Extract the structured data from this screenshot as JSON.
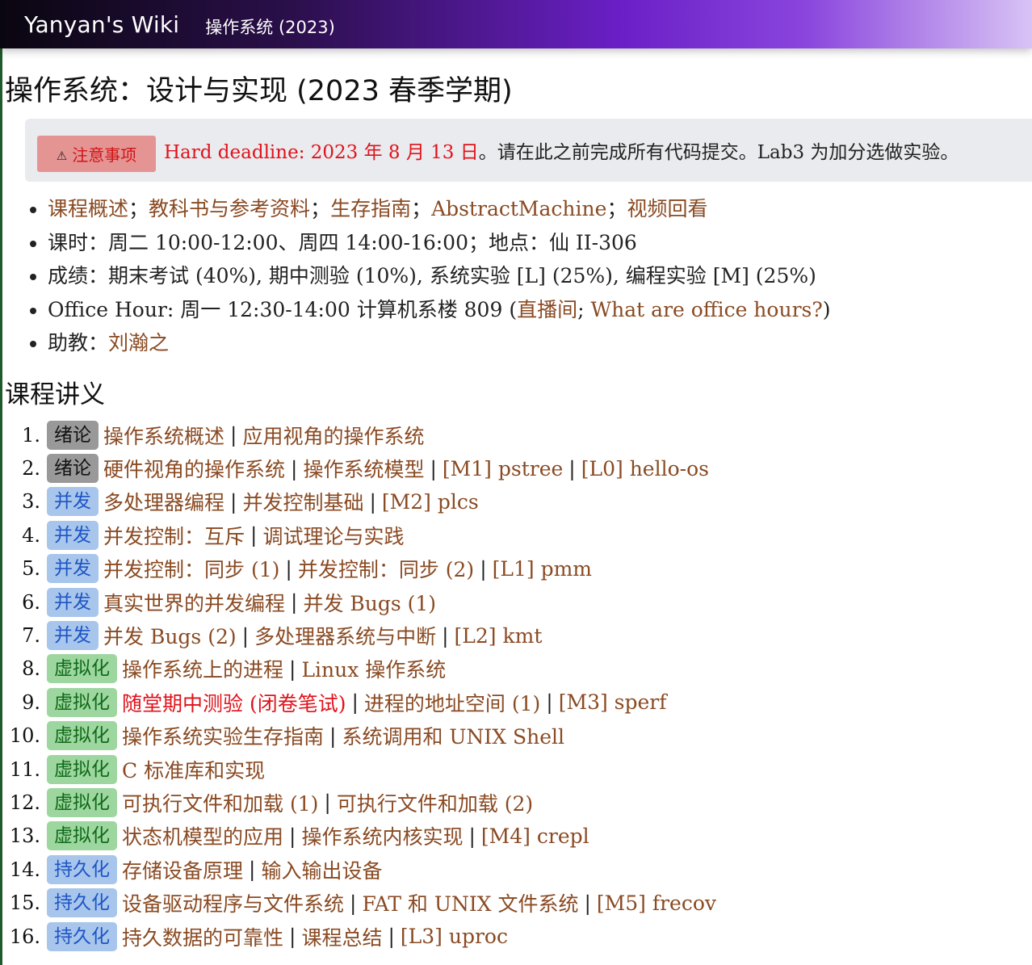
{
  "nav": {
    "brand": "Yanyan's Wiki",
    "link": "操作系统 (2023)"
  },
  "page_title": "操作系统：设计与实现 (2023 春季学期)",
  "notice": {
    "badge": "注意事项",
    "deadline": "Hard deadline: 2023 年 8 月 13 日",
    "rest": "。请在此之前完成所有代码提交。Lab3 为加分选做实验。"
  },
  "info": {
    "links_line": {
      "a1": "课程概述",
      "a2": "教科书与参考资料",
      "a3": "生存指南",
      "a4": "AbstractMachine",
      "a5": "视频回看",
      "sep": "；"
    },
    "hours": "课时：周二 10:00-12:00、周四 14:00-16:00；地点：仙 II-306",
    "grading": "成绩：期末考试 (40%), 期中测验 (10%), 系统实验 [L] (25%), 编程实验 [M] (25%)",
    "office": {
      "prefix": "Office Hour: 周一 12:30-14:00 计算机系楼 809 (",
      "live": "直播间",
      "mid": "; ",
      "what": "What are office hours?",
      "suffix": ")"
    },
    "ta": {
      "label": "助教：",
      "name": "刘瀚之"
    }
  },
  "section_title": "课程讲义",
  "colors": {
    "link": "#8a4a22",
    "red": "#e0121b",
    "tag_gray": "#999999",
    "tag_blue": "#a8c6ec",
    "tag_green": "#9ed6a0"
  },
  "separator": "|",
  "lectures": [
    {
      "num": "1.",
      "tag": "绪论",
      "items": [
        "操作系统概述",
        "应用视角的操作系统"
      ]
    },
    {
      "num": "2.",
      "tag": "绪论",
      "items": [
        "硬件视角的操作系统",
        "操作系统模型",
        "[M1] pstree",
        "[L0] hello-os"
      ]
    },
    {
      "num": "3.",
      "tag": "并发",
      "items": [
        "多处理器编程",
        "并发控制基础",
        "[M2] plcs"
      ]
    },
    {
      "num": "4.",
      "tag": "并发",
      "items": [
        "并发控制：互斥",
        "调试理论与实践"
      ]
    },
    {
      "num": "5.",
      "tag": "并发",
      "items": [
        "并发控制：同步 (1)",
        "并发控制：同步 (2)",
        "[L1] pmm"
      ]
    },
    {
      "num": "6.",
      "tag": "并发",
      "items": [
        "真实世界的并发编程",
        "并发 Bugs (1)"
      ]
    },
    {
      "num": "7.",
      "tag": "并发",
      "items": [
        "并发 Bugs (2)",
        "多处理器系统与中断",
        "[L2] kmt"
      ]
    },
    {
      "num": "8.",
      "tag": "虚拟化",
      "items": [
        "操作系统上的进程",
        "Linux 操作系统"
      ]
    },
    {
      "num": "9.",
      "tag": "虚拟化",
      "items": [
        "随堂期中测验 (闭卷笔试)",
        "进程的地址空间 (1)",
        "[M3] sperf"
      ]
    },
    {
      "num": "10.",
      "tag": "虚拟化",
      "items": [
        "操作系统实验生存指南",
        "系统调用和 UNIX Shell"
      ]
    },
    {
      "num": "11.",
      "tag": "虚拟化",
      "items": [
        "C 标准库和实现"
      ]
    },
    {
      "num": "12.",
      "tag": "虚拟化",
      "items": [
        "可执行文件和加载 (1)",
        "可执行文件和加载 (2)"
      ]
    },
    {
      "num": "13.",
      "tag": "虚拟化",
      "items": [
        "状态机模型的应用",
        "操作系统内核实现",
        "[M4] crepl"
      ]
    },
    {
      "num": "14.",
      "tag": "持久化",
      "items": [
        "存储设备原理",
        "输入输出设备"
      ]
    },
    {
      "num": "15.",
      "tag": "持久化",
      "items": [
        "设备驱动程序与文件系统",
        "FAT 和 UNIX 文件系统",
        "[M5] frecov"
      ]
    },
    {
      "num": "16.",
      "tag": "持久化",
      "items": [
        "持久数据的可靠性",
        "课程总结",
        "[L3] uproc"
      ]
    }
  ]
}
